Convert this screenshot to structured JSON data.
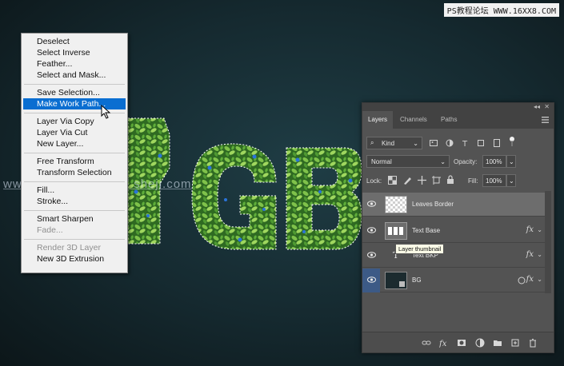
{
  "watermarks": {
    "top": "PS教程论坛 WWW.16XX8.COM",
    "middle": "www.missyuan.com / sheji.com"
  },
  "artwork": {
    "leaf_color_dark": "#2f6a22",
    "leaf_color_light": "#7fc24a",
    "dot_color": "#2a73d9"
  },
  "context_menu": {
    "items": [
      {
        "label": "Deselect",
        "state": "normal"
      },
      {
        "label": "Select Inverse",
        "state": "normal"
      },
      {
        "label": "Feather...",
        "state": "normal"
      },
      {
        "label": "Select and Mask...",
        "state": "normal"
      },
      {
        "label": "Save Selection...",
        "state": "normal"
      },
      {
        "label": "Make Work Path...",
        "state": "highlighted"
      },
      {
        "label": "Layer Via Copy",
        "state": "normal"
      },
      {
        "label": "Layer Via Cut",
        "state": "normal"
      },
      {
        "label": "New Layer...",
        "state": "normal"
      },
      {
        "label": "Free Transform",
        "state": "normal"
      },
      {
        "label": "Transform Selection",
        "state": "normal"
      },
      {
        "label": "Fill...",
        "state": "normal"
      },
      {
        "label": "Stroke...",
        "state": "normal"
      },
      {
        "label": "Smart Sharpen",
        "state": "normal"
      },
      {
        "label": "Fade...",
        "state": "disabled"
      },
      {
        "label": "Render 3D Layer",
        "state": "disabled"
      },
      {
        "label": "New 3D Extrusion",
        "state": "normal"
      }
    ],
    "highlight_color": "#0a6ed1"
  },
  "layers_panel": {
    "tabs": [
      {
        "label": "Layers",
        "active": true
      },
      {
        "label": "Channels",
        "active": false
      },
      {
        "label": "Paths",
        "active": false
      }
    ],
    "filter": {
      "label": "Kind"
    },
    "blend_mode": "Normal",
    "opacity": {
      "label": "Opacity:",
      "value": "100%"
    },
    "lock": {
      "label": "Lock:"
    },
    "fill": {
      "label": "Fill:",
      "value": "100%"
    },
    "layers": [
      {
        "name": "Leaves Border",
        "selected": true,
        "fx": false,
        "thumbnail": "checker"
      },
      {
        "name": "Text Base",
        "selected": false,
        "fx": true,
        "thumbnail": "text"
      },
      {
        "name": "Text BKP",
        "selected": false,
        "fx": true,
        "thumbnail": "type"
      },
      {
        "name": "BG",
        "selected": false,
        "fx": true,
        "thumbnail": "dark"
      }
    ],
    "tooltip": "Layer thumbnail",
    "fx_symbol": "fx",
    "bottom_icons": [
      "link-icon",
      "fx-icon",
      "mask-icon",
      "adjustment-icon",
      "group-icon",
      "new-layer-icon",
      "trash-icon"
    ]
  }
}
